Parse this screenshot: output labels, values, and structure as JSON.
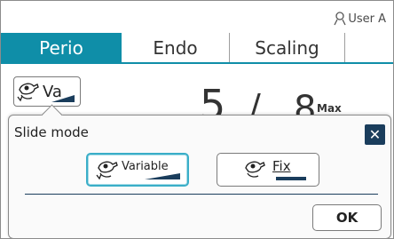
{
  "header": {
    "user_label": "User A"
  },
  "tabs": [
    {
      "label": "Perio",
      "active": true
    },
    {
      "label": "Endo",
      "active": false
    },
    {
      "label": "Scaling",
      "active": false
    },
    {
      "label": "",
      "active": false
    }
  ],
  "mode_button": {
    "label": "Va"
  },
  "readout": {
    "current": "5",
    "separator": "/",
    "max_value": "8",
    "max_label": "Max"
  },
  "dialog": {
    "title": "Slide mode",
    "options": [
      {
        "label": "Variable",
        "selected": true
      },
      {
        "label": "Fix",
        "selected": false
      }
    ],
    "ok_label": "OK"
  },
  "colors": {
    "accent": "#0f8ea8",
    "dark": "#1a3d5c",
    "selected_border": "#3aaec8"
  }
}
